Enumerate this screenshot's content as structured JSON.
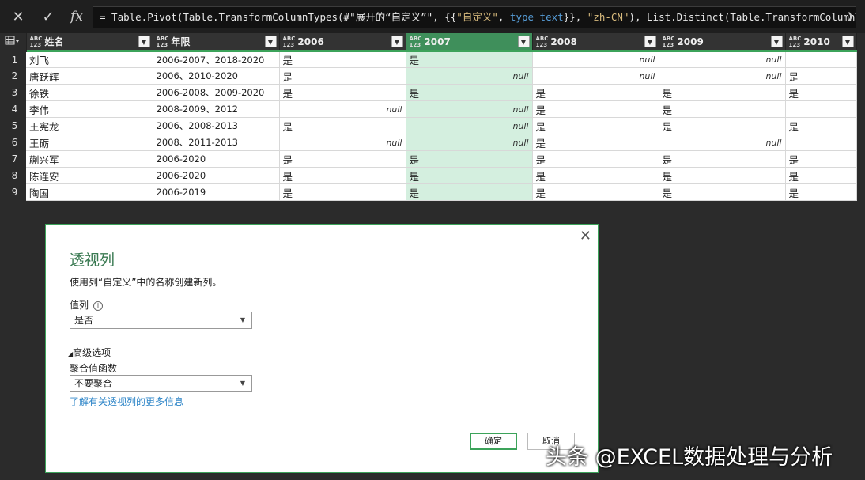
{
  "formula_bar": {
    "p1": "= Table.Pivot(Table.TransformColumnTypes(#\"展开的“自定义”\", {{",
    "p2": "\"自定义\"",
    "p3": ", ",
    "p4": "type text",
    "p5": "}}, ",
    "p6": "\"zh-CN\"",
    "p7": "), List.Distinct(Table.TransformColumnTypes(#\"展开"
  },
  "grid": {
    "type_label_top": "ABC",
    "type_label_bottom": "123",
    "headers": [
      "姓名",
      "年限",
      "2006",
      "2007",
      "2008",
      "2009",
      "2010"
    ],
    "rows": [
      [
        "刘飞",
        "2006-2007、2018-2020",
        "是",
        "是",
        "null",
        "null",
        ""
      ],
      [
        "唐跃辉",
        "2006、2010-2020",
        "是",
        "null",
        "null",
        "null",
        "是"
      ],
      [
        "徐铁",
        "2006-2008、2009-2020",
        "是",
        "是",
        "是",
        "是",
        "是"
      ],
      [
        "李伟",
        "2008-2009、2012",
        "null",
        "null",
        "是",
        "是",
        ""
      ],
      [
        "王宪龙",
        "2006、2008-2013",
        "是",
        "null",
        "是",
        "是",
        "是"
      ],
      [
        "王砺",
        "2008、2011-2013",
        "null",
        "null",
        "是",
        "null",
        ""
      ],
      [
        "蒯兴军",
        "2006-2020",
        "是",
        "是",
        "是",
        "是",
        "是"
      ],
      [
        "陈连安",
        "2006-2020",
        "是",
        "是",
        "是",
        "是",
        "是"
      ],
      [
        "陶国",
        "2006-2019",
        "是",
        "是",
        "是",
        "是",
        "是"
      ]
    ]
  },
  "dialog": {
    "title": "透视列",
    "description": "使用列“自定义”中的名称创建新列。",
    "values_label": "值列",
    "info_glyph": "i",
    "values_selected": "是否",
    "advanced_label": "高级选项",
    "agg_label": "聚合值函数",
    "agg_selected": "不要聚合",
    "learn_more": "了解有关透视列的更多信息",
    "ok_label": "确定",
    "cancel_label": "取消"
  },
  "watermark": "头条 @EXCEL数据处理与分析",
  "colors": {
    "accent_green": "#3ca35a",
    "selected_column": "#d4efdf",
    "link": "#2f86c8"
  }
}
